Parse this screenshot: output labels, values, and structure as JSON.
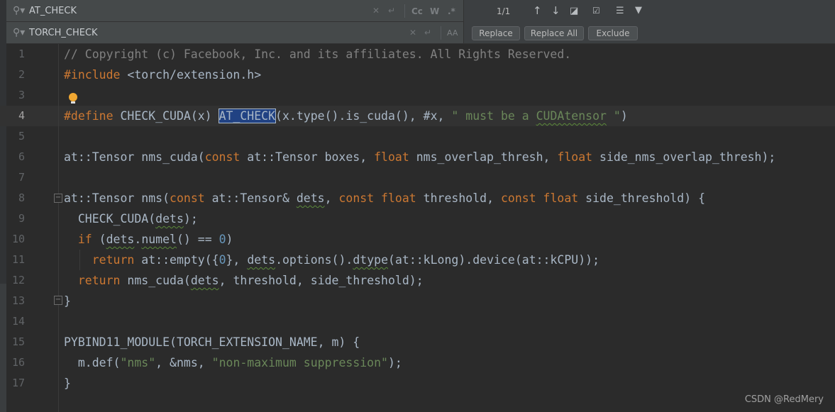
{
  "find": {
    "value": "AT_CHECK",
    "clear_icon": "close-icon",
    "newline_icon": "newline-icon",
    "options": [
      "Cc",
      "W",
      ".*"
    ]
  },
  "replace": {
    "value": "TORCH_CHECK",
    "preserve_case": "AA"
  },
  "results": {
    "count": "1/1"
  },
  "buttons": {
    "replace": "Replace",
    "replace_all": "Replace All",
    "exclude": "Exclude"
  },
  "code": {
    "current_line": 4,
    "line_numbers": [
      "1",
      "2",
      "3",
      "4",
      "5",
      "6",
      "7",
      "8",
      "9",
      "10",
      "11",
      "12",
      "13",
      "14",
      "15",
      "16",
      "17"
    ],
    "lines": [
      [
        [
          "c",
          "// Copyright (c) Facebook, Inc. and its affiliates. All Rights Reserved."
        ]
      ],
      [
        [
          "k",
          "#include"
        ],
        [
          "t",
          " <torch/extension.h>"
        ]
      ],
      [],
      [
        [
          "k",
          "#define"
        ],
        [
          "t",
          " CHECK_CUDA(x) "
        ],
        [
          "sel",
          "AT_CHECK"
        ],
        [
          "t",
          "(x.type().is_cuda(), #x, "
        ],
        [
          "s",
          "\" must be a "
        ],
        [
          "s w",
          "CUDAtensor"
        ],
        [
          "s",
          " \""
        ],
        [
          "t",
          ")"
        ]
      ],
      [],
      [
        [
          "t",
          "at::Tensor nms_cuda("
        ],
        [
          "k",
          "const"
        ],
        [
          "t",
          " at::Tensor boxes, "
        ],
        [
          "k",
          "float"
        ],
        [
          "t",
          " nms_overlap_thresh, "
        ],
        [
          "k",
          "float"
        ],
        [
          "t",
          " side_nms_overlap_thresh);"
        ]
      ],
      [],
      [
        [
          "t",
          "at::Tensor nms("
        ],
        [
          "k",
          "const"
        ],
        [
          "t",
          " at::Tensor& "
        ],
        [
          "w",
          "dets"
        ],
        [
          "t",
          ", "
        ],
        [
          "k",
          "const float"
        ],
        [
          "t",
          " threshold, "
        ],
        [
          "k",
          "const float"
        ],
        [
          "t",
          " side_threshold) {"
        ]
      ],
      [
        [
          "t",
          "  CHECK_CUDA("
        ],
        [
          "w",
          "dets"
        ],
        [
          "t",
          ");"
        ]
      ],
      [
        [
          "k",
          "  if"
        ],
        [
          "t",
          " ("
        ],
        [
          "w",
          "dets"
        ],
        [
          "t",
          "."
        ],
        [
          "w",
          "numel"
        ],
        [
          "t",
          "() == "
        ],
        [
          "n",
          "0"
        ],
        [
          "t",
          ")"
        ]
      ],
      [
        [
          "k",
          "    return"
        ],
        [
          "t",
          " at::empty({"
        ],
        [
          "n",
          "0"
        ],
        [
          "t",
          "}, "
        ],
        [
          "w",
          "dets"
        ],
        [
          "t",
          ".options()."
        ],
        [
          "w",
          "dtype"
        ],
        [
          "t",
          "(at::kLong).device(at::kCPU));"
        ]
      ],
      [
        [
          "k",
          "  return"
        ],
        [
          "t",
          " nms_cuda("
        ],
        [
          "w",
          "dets"
        ],
        [
          "t",
          ", threshold, side_threshold);"
        ]
      ],
      [
        [
          "t",
          "}"
        ]
      ],
      [],
      [
        [
          "t",
          "PYBIND11_MODULE(TORCH_EXTENSION_NAME, m) {"
        ]
      ],
      [
        [
          "t",
          "  m.def("
        ],
        [
          "s",
          "\"nms\""
        ],
        [
          "t",
          ", &nms, "
        ],
        [
          "s",
          "\"non-maximum suppression\""
        ],
        [
          "t",
          ");"
        ]
      ],
      [
        [
          "t",
          "}"
        ]
      ]
    ]
  },
  "watermark": "CSDN @RedMery"
}
